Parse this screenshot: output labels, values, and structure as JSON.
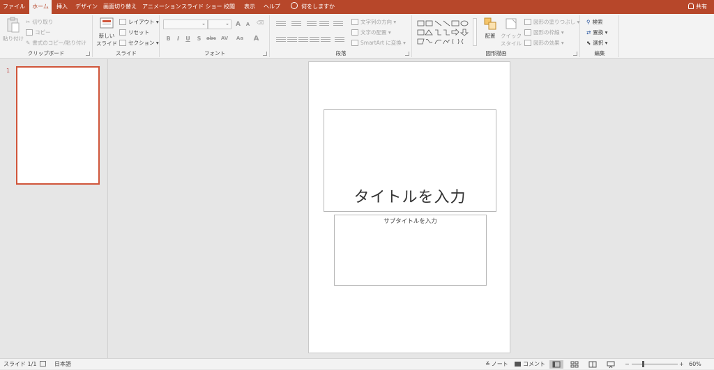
{
  "tabs": {
    "file": "ファイル",
    "home": "ホーム",
    "insert": "挿入",
    "design": "デザイン",
    "transitions": "画面切り替え",
    "animations": "アニメーション",
    "slideshow": "スライド ショー",
    "review": "校閲",
    "view": "表示",
    "help": "ヘルプ"
  },
  "tellme": "何をしますか",
  "share": "共有",
  "ribbon": {
    "clipboard": {
      "paste": "貼り付け",
      "cut": "切り取り",
      "copy": "コピー",
      "format_painter": "書式のコピー/貼り付け",
      "label": "クリップボード"
    },
    "slides": {
      "new_slide_1": "新しい",
      "new_slide_2": "スライド",
      "layout": "レイアウト",
      "reset": "リセット",
      "section": "セクション",
      "label": "スライド"
    },
    "font": {
      "label": "フォント",
      "bold": "B",
      "italic": "I",
      "underline": "U",
      "shadow": "S",
      "strike": "abc",
      "spacing": "AV",
      "case": "Aa",
      "color": "A",
      "grow": "A",
      "shrink": "A"
    },
    "paragraph": {
      "label": "段落",
      "text_direction": "文字列の方向",
      "align_text": "文字の配置",
      "smartart": "SmartArt に変換"
    },
    "drawing": {
      "label": "図形描画",
      "arrange": "配置",
      "quick_styles_1": "クイック",
      "quick_styles_2": "スタイル",
      "shape_fill": "図形の塗りつぶし",
      "shape_outline": "図形の枠線",
      "shape_effects": "図形の効果"
    },
    "editing": {
      "label": "編集",
      "find": "検索",
      "replace": "置換",
      "select": "選択"
    }
  },
  "thumbnail": {
    "number": "1"
  },
  "slide": {
    "title_placeholder": "タイトルを入力",
    "subtitle_placeholder": "サブタイトルを入力"
  },
  "status": {
    "slide_info": "スライド 1/1",
    "language": "日本語",
    "notes": "ノート",
    "comments": "コメント",
    "zoom_minus": "−",
    "zoom_plus": "+",
    "zoom": "60%"
  },
  "colors": {
    "accent": "#b7472a",
    "thumb_border": "#d0553a"
  }
}
